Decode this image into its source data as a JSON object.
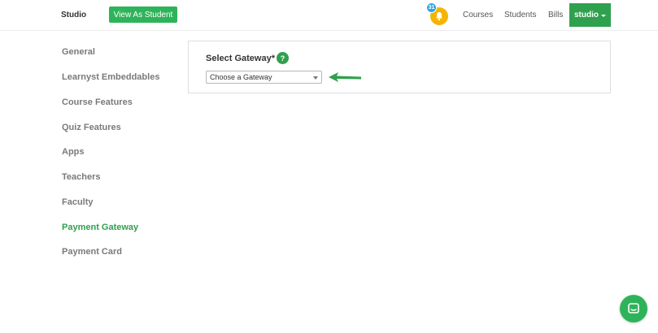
{
  "header": {
    "brand": "Studio",
    "view_as_student": "View As Student",
    "notification_count": "31",
    "nav": [
      "Courses",
      "Students",
      "Bills"
    ],
    "user_menu": "studio",
    "accent_color": "#2fa04e",
    "bell_color": "#f5b400",
    "badge_color": "#2ea6e6"
  },
  "sidebar": {
    "items": [
      {
        "label": "General"
      },
      {
        "label": "Learnyst Embeddables"
      },
      {
        "label": "Course Features"
      },
      {
        "label": "Quiz Features"
      },
      {
        "label": "Apps"
      },
      {
        "label": "Teachers"
      },
      {
        "label": "Faculty"
      },
      {
        "label": "Payment Gateway"
      },
      {
        "label": "Payment Card"
      }
    ],
    "active_index": 7
  },
  "main": {
    "gateway_label": "Select Gateway*",
    "help_glyph": "?",
    "gateway_select": {
      "value": "Choose a Gateway"
    }
  },
  "icons": {
    "notification": "bell-icon",
    "help": "question-icon",
    "pointer": "arrow-left-icon",
    "chat": "chat-icon"
  }
}
